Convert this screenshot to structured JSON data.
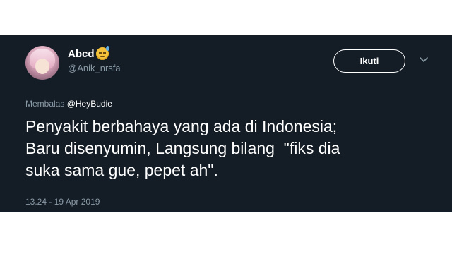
{
  "tweet": {
    "display_name": "Abcd",
    "emoji_icon": "sad-sweat-emoji-icon",
    "handle": "@Anik_nrsfa",
    "follow_label": "Ikuti",
    "reply_prefix": "Membalas",
    "reply_mention": "@HeyBudie",
    "text": "Penyakit berbahaya yang ada di Indonesia;\nBaru disenyumin, Langsung bilang  \"fiks dia\nsuka sama gue, pepet ah\".",
    "timestamp": "13.24 - 19 Apr 2019"
  },
  "colors": {
    "background": "#141d26",
    "text": "#ffffff",
    "muted": "#8899a6"
  }
}
